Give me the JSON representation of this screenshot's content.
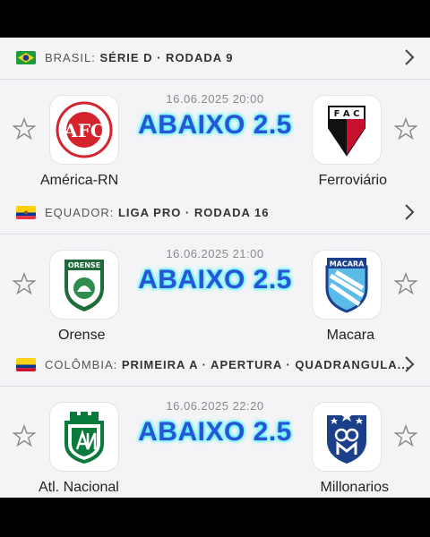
{
  "groups": [
    {
      "league": {
        "country": "BRASIL:",
        "competition": "SÉRIE D · RODADA 9"
      },
      "match": {
        "datetime": "16.06.2025 20:00",
        "home": "América-RN",
        "away": "Ferroviário",
        "pick": "ABAIXO 2.5"
      }
    },
    {
      "league": {
        "country": "EQUADOR:",
        "competition": "LIGA PRO · RODADA 16"
      },
      "match": {
        "datetime": "16.06.2025 21:00",
        "home": "Orense",
        "away": "Macara",
        "pick": "ABAIXO 2.5"
      }
    },
    {
      "league": {
        "country": "COLÔMBIA:",
        "competition": "PRIMEIRA A · APERTURA · QUADRANGULA..."
      },
      "match": {
        "datetime": "16.06.2025 22:20",
        "home": "Atl. Nacional",
        "away": "Millonarios",
        "pick": "ABAIXO 2.5"
      }
    }
  ],
  "logo_text": {
    "ferroviario": "F A C",
    "orense": "ORENSE",
    "macara": "MACARA"
  },
  "icons": [
    "star-outline-icon",
    "chevron-right-icon",
    "brazil-flag-icon",
    "ecuador-flag-icon",
    "colombia-flag-icon"
  ],
  "colors": {
    "pick_text": "#2a53d6",
    "pick_glow": "#3ef3ff",
    "background": "#f4f4f6"
  }
}
